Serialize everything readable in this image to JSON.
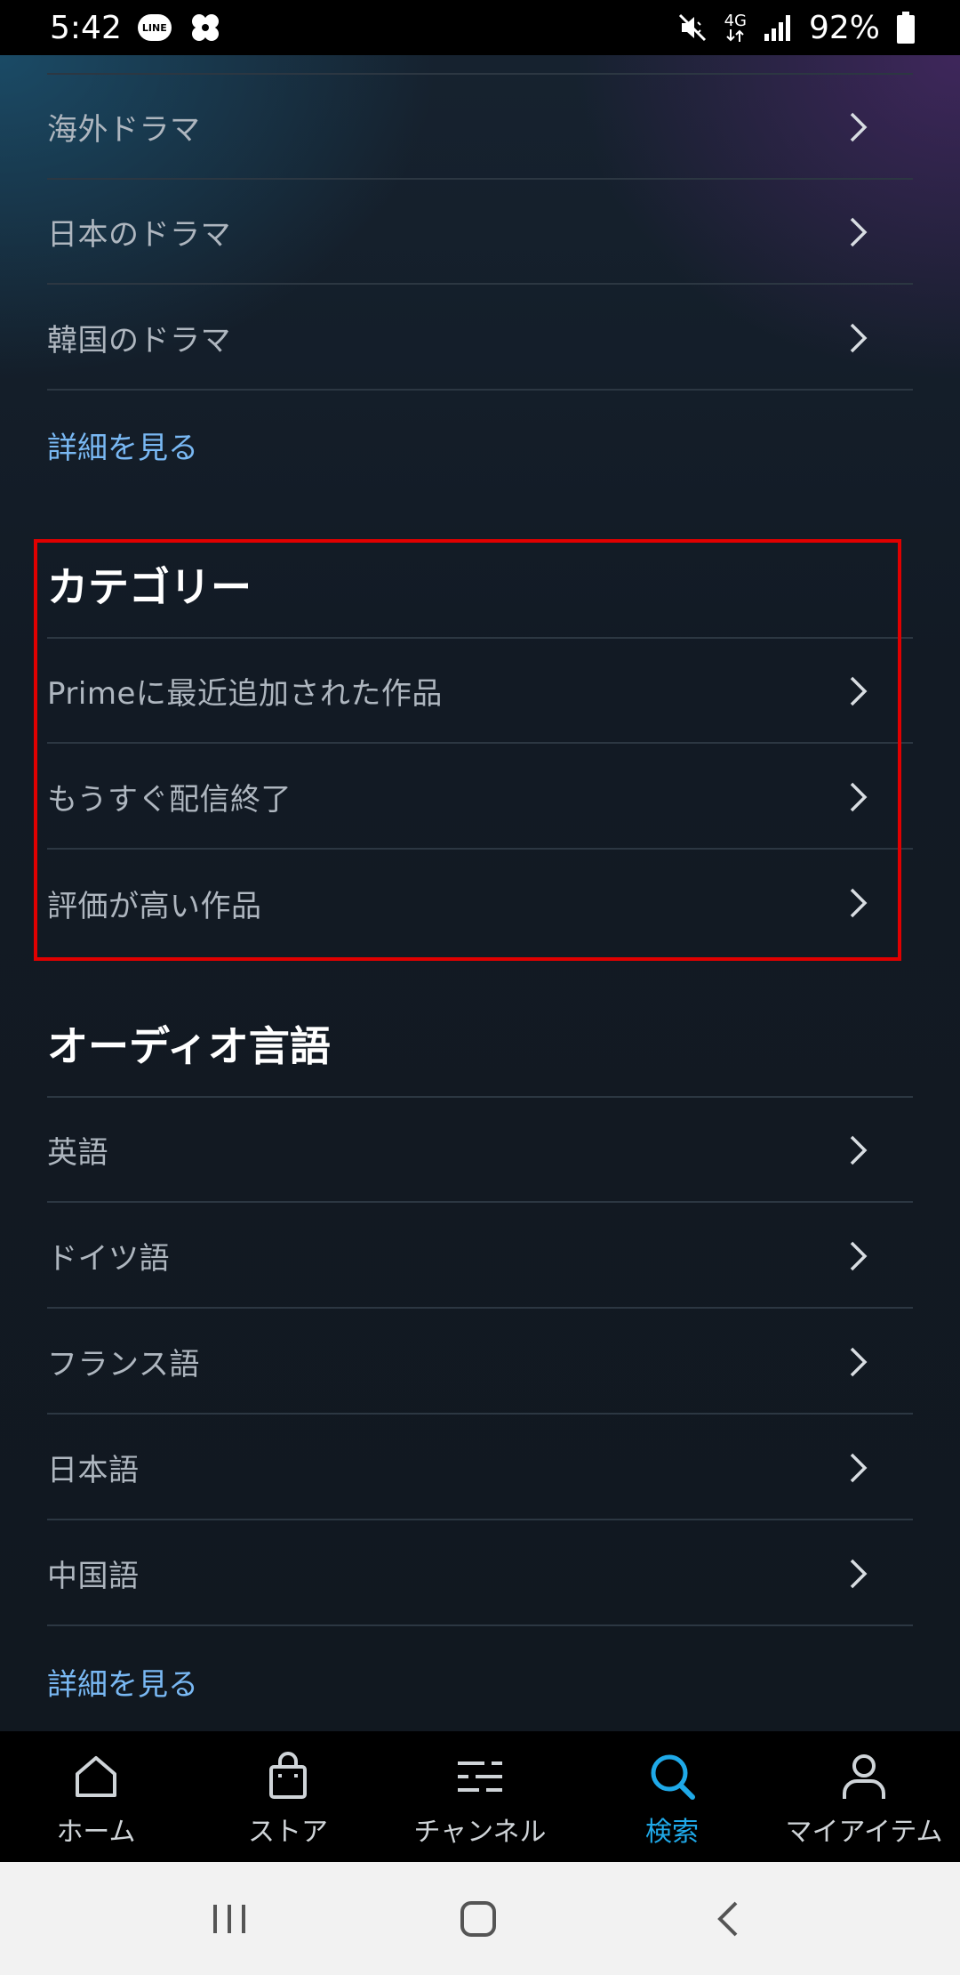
{
  "status_bar": {
    "time": "5:42",
    "line_badge": "LINE",
    "network": "4G",
    "battery": "92%",
    "icons": [
      "line-icon",
      "pinwheel-icon",
      "mute-icon",
      "network-4g-icon",
      "signal-icon",
      "battery-icon"
    ]
  },
  "genre_rows": [
    {
      "label": "海外ドラマ"
    },
    {
      "label": "日本のドラマ"
    },
    {
      "label": "韓国のドラマ"
    }
  ],
  "genre_more": "詳細を見る",
  "categories": {
    "title": "カテゴリー",
    "items": [
      {
        "label": "Primeに最近追加された作品"
      },
      {
        "label": "もうすぐ配信終了"
      },
      {
        "label": "評価が高い作品"
      }
    ]
  },
  "audio_languages": {
    "title": "オーディオ言語",
    "items": [
      {
        "label": "英語"
      },
      {
        "label": "ドイツ語"
      },
      {
        "label": "フランス語"
      },
      {
        "label": "日本語"
      },
      {
        "label": "中国語"
      }
    ],
    "more": "詳細を見る"
  },
  "bottom_nav": {
    "items": [
      {
        "label": "ホーム",
        "icon": "home-icon"
      },
      {
        "label": "ストア",
        "icon": "store-bag-icon"
      },
      {
        "label": "チャンネル",
        "icon": "channels-icon"
      },
      {
        "label": "検索",
        "icon": "search-icon",
        "active": true
      },
      {
        "label": "マイアイテム",
        "icon": "person-icon"
      }
    ],
    "active_color": "#1fa9e8"
  },
  "colors": {
    "highlight_box": "#e00000",
    "link": "#79b8f3"
  }
}
